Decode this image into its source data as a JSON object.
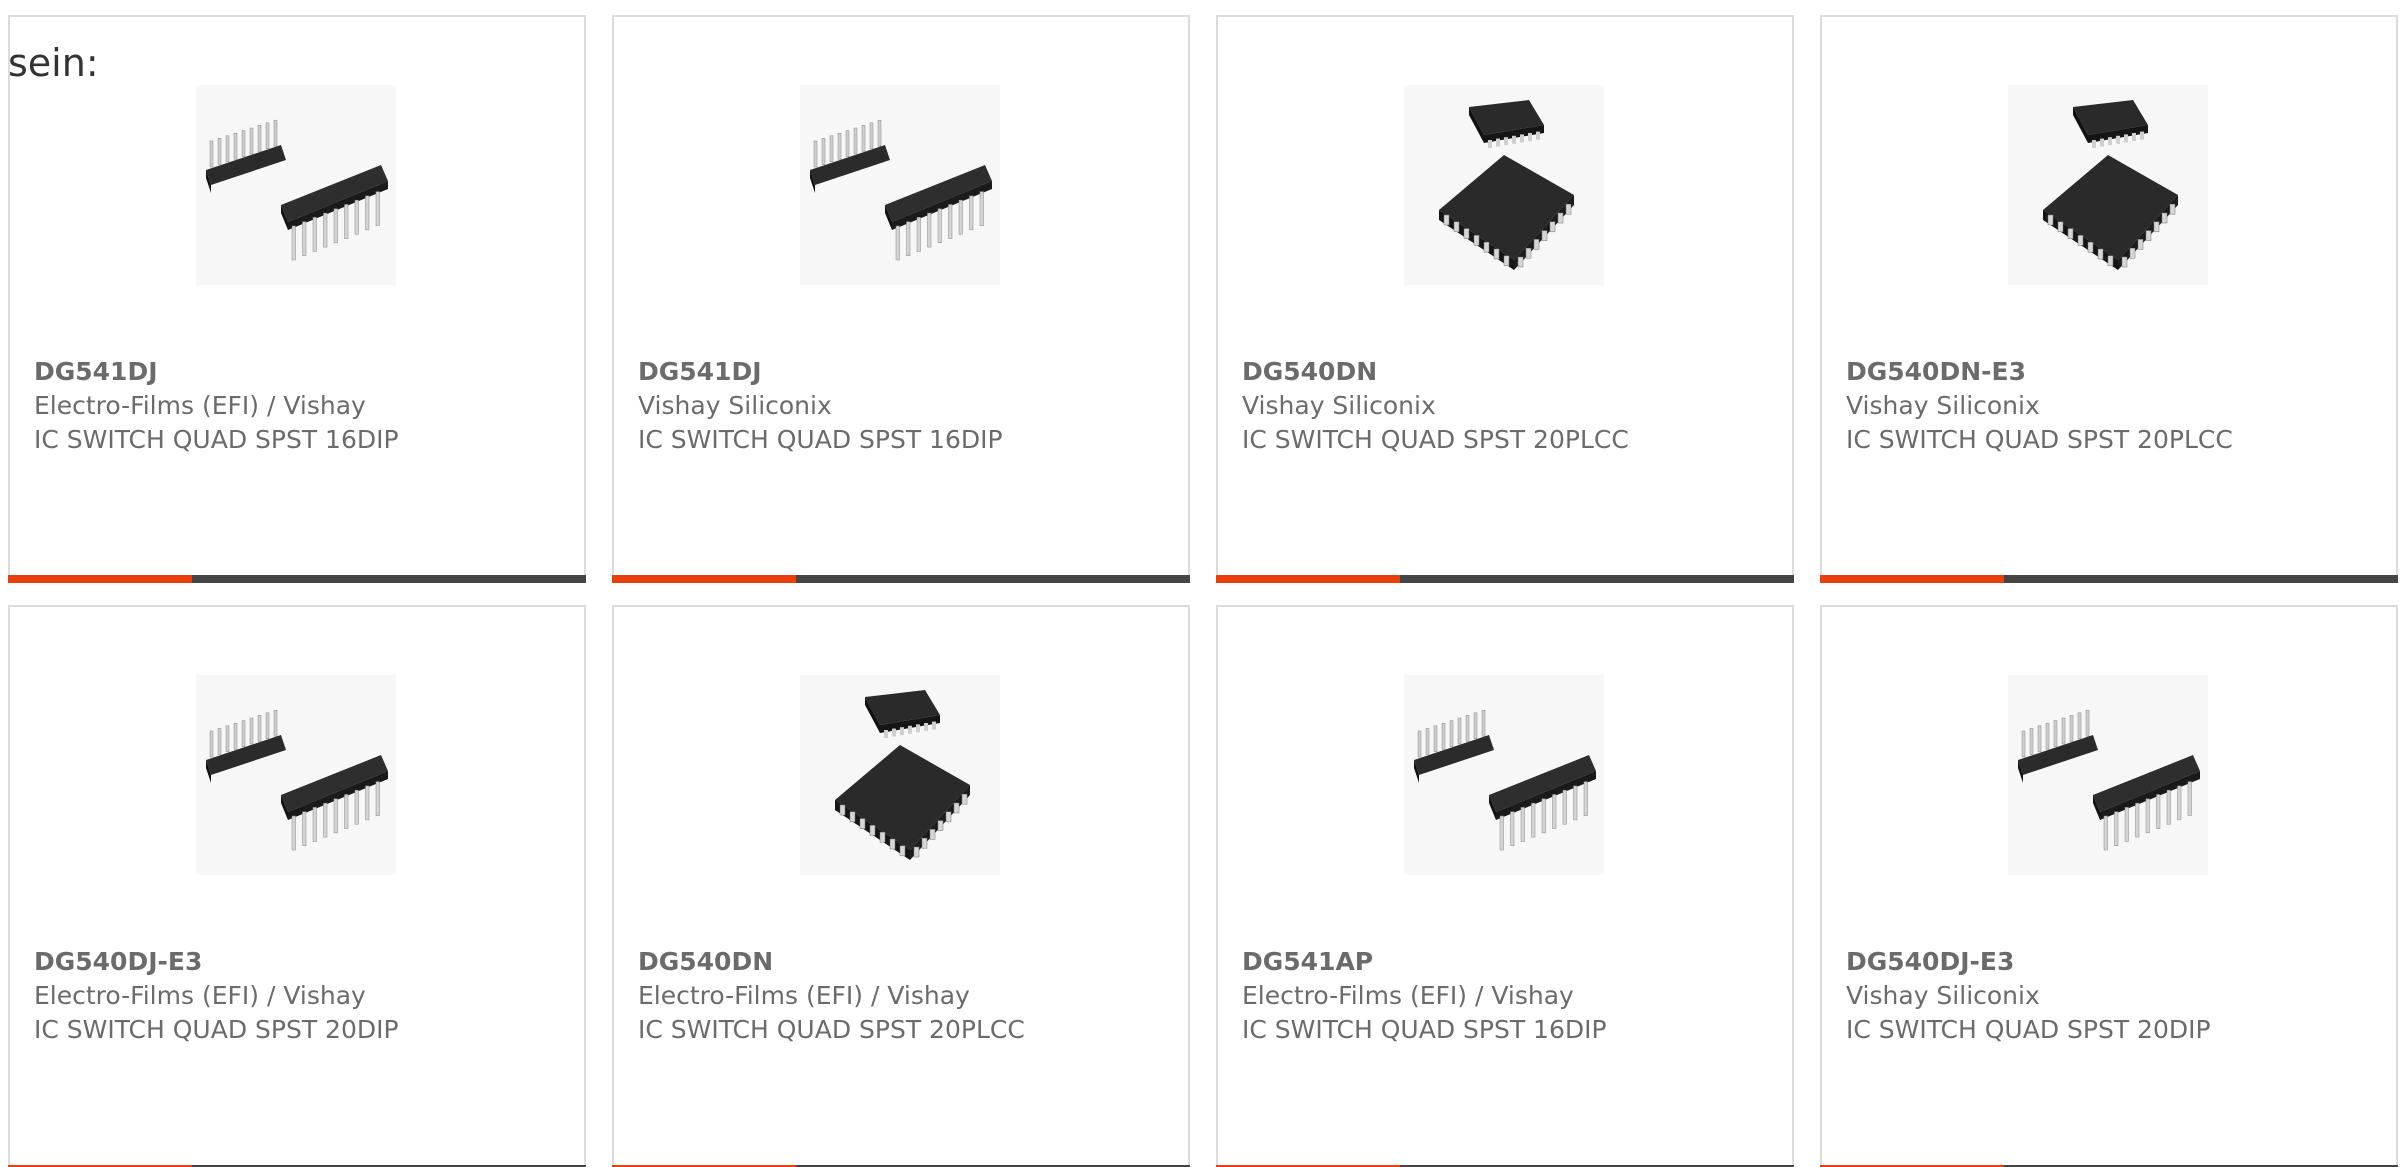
{
  "intro_text": "sein:",
  "colors": {
    "accent": "#e8400c",
    "bar": "#454545",
    "border": "#dcdcdc",
    "text": "#6b6b6b"
  },
  "products": [
    {
      "part": "DG541DJ",
      "maker": "Electro-Films (EFI) / Vishay",
      "desc": "IC SWITCH QUAD SPST 16DIP",
      "icon": "dip-chip-icon"
    },
    {
      "part": "DG541DJ",
      "maker": "Vishay Siliconix",
      "desc": "IC SWITCH QUAD SPST 16DIP",
      "icon": "dip-chip-icon"
    },
    {
      "part": "DG540DN",
      "maker": "Vishay Siliconix",
      "desc": "IC SWITCH QUAD SPST 20PLCC",
      "icon": "plcc-chip-icon"
    },
    {
      "part": "DG540DN-E3",
      "maker": "Vishay Siliconix",
      "desc": "IC SWITCH QUAD SPST 20PLCC",
      "icon": "plcc-chip-icon"
    },
    {
      "part": "DG540DJ-E3",
      "maker": "Electro-Films (EFI) / Vishay",
      "desc": "IC SWITCH QUAD SPST 20DIP",
      "icon": "dip-chip-icon"
    },
    {
      "part": "DG540DN",
      "maker": "Electro-Films (EFI) / Vishay",
      "desc": "IC SWITCH QUAD SPST 20PLCC",
      "icon": "plcc-chip-icon"
    },
    {
      "part": "DG541AP",
      "maker": "Electro-Films (EFI) / Vishay",
      "desc": "IC SWITCH QUAD SPST 16DIP",
      "icon": "dip-chip-icon"
    },
    {
      "part": "DG540DJ-E3",
      "maker": "Vishay Siliconix",
      "desc": "IC SWITCH QUAD SPST 20DIP",
      "icon": "dip-chip-icon"
    }
  ]
}
